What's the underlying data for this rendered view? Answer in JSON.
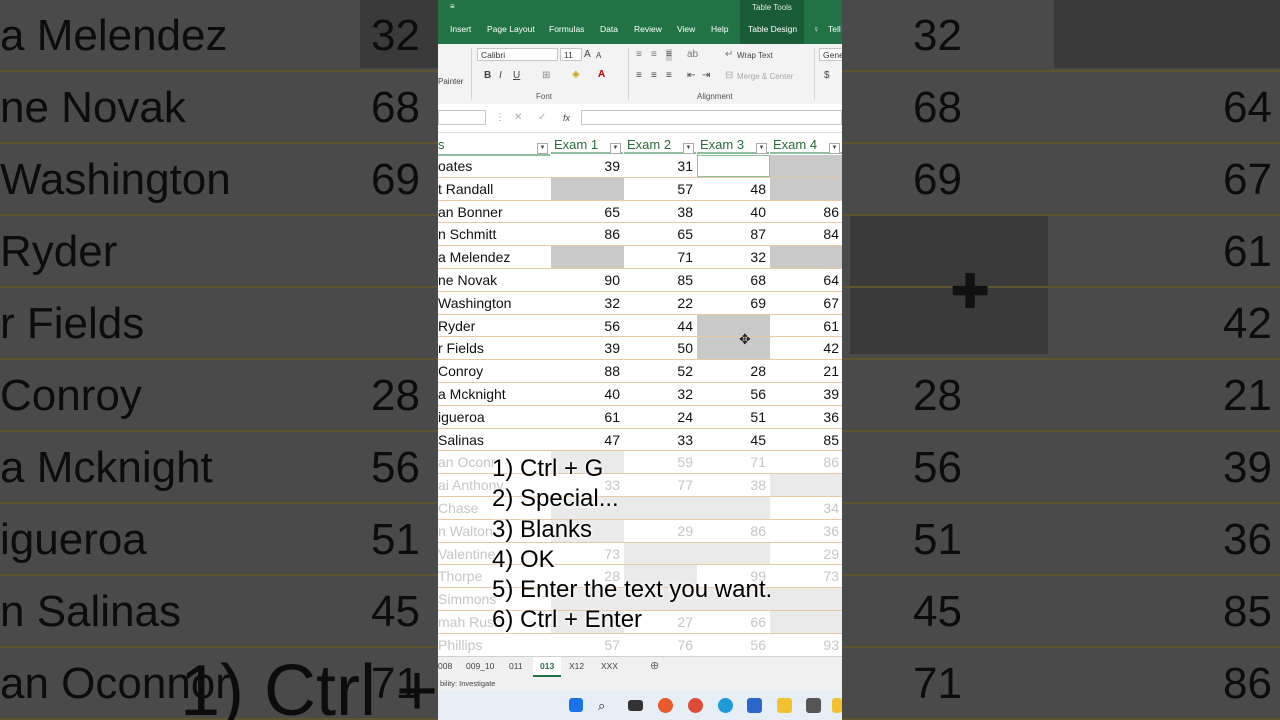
{
  "ribbon_tabs": [
    "Insert",
    "Page Layout",
    "Formulas",
    "Data",
    "Review",
    "View",
    "Help",
    "Table Design",
    "Tell"
  ],
  "table_tools_label": "Table Tools",
  "ribbon": {
    "painter": "Painter",
    "font_name": "Calibri",
    "font_size": "11",
    "wrap_text": "Wrap Text",
    "merge_center": "Merge & Center",
    "number_format": "Gene",
    "group_font": "Font",
    "group_alignment": "Alignment",
    "bold": "B",
    "italic": "I",
    "underline": "U",
    "currency": "$"
  },
  "formula_bar": {
    "fx": "fx"
  },
  "columns": {
    "name_suffix": "s",
    "exam1": "Exam 1",
    "exam2": "Exam 2",
    "exam3": "Exam 3",
    "exam4": "Exam 4"
  },
  "rows": [
    {
      "name": "oates",
      "e1": "39",
      "e2": "31",
      "e3": "",
      "e4": ""
    },
    {
      "name": "t Randall",
      "e1": "",
      "e2": "57",
      "e3": "48",
      "e4": ""
    },
    {
      "name": "an Bonner",
      "e1": "65",
      "e2": "38",
      "e3": "40",
      "e4": "86"
    },
    {
      "name": "n Schmitt",
      "e1": "86",
      "e2": "65",
      "e3": "87",
      "e4": "84"
    },
    {
      "name": "a Melendez",
      "e1": "",
      "e2": "71",
      "e3": "32",
      "e4": ""
    },
    {
      "name": "ne Novak",
      "e1": "90",
      "e2": "85",
      "e3": "68",
      "e4": "64"
    },
    {
      "name": " Washington",
      "e1": "32",
      "e2": "22",
      "e3": "69",
      "e4": "67"
    },
    {
      "name": " Ryder",
      "e1": "56",
      "e2": "44",
      "e3": "",
      "e4": "61"
    },
    {
      "name": "r Fields",
      "e1": "39",
      "e2": "50",
      "e3": "",
      "e4": "42"
    },
    {
      "name": "Conroy",
      "e1": "88",
      "e2": "52",
      "e3": "28",
      "e4": "21"
    },
    {
      "name": "a Mcknight",
      "e1": "40",
      "e2": "32",
      "e3": "56",
      "e4": "39"
    },
    {
      "name": "igueroa",
      "e1": "61",
      "e2": "24",
      "e3": "51",
      "e4": "36"
    },
    {
      "name": " Salinas",
      "e1": "47",
      "e2": "33",
      "e3": "45",
      "e4": "85"
    },
    {
      "name": "an Oconr",
      "e1": "",
      "e2": "59",
      "e3": "71",
      "e4": "86"
    },
    {
      "name": "ai Anthony",
      "e1": "33",
      "e2": "77",
      "e3": "38",
      "e4": ""
    },
    {
      "name": " Chase",
      "e1": "",
      "e2": "",
      "e3": "",
      "e4": "34"
    },
    {
      "name": "n Walton",
      "e1": "",
      "e2": "29",
      "e3": "86",
      "e4": "36"
    },
    {
      "name": " Valentine",
      "e1": "73",
      "e2": "",
      "e3": "",
      "e4": "29"
    },
    {
      "name": " Thorpe",
      "e1": "28",
      "e2": "",
      "e3": "99",
      "e4": "73"
    },
    {
      "name": " Simmons",
      "e1": "",
      "e2": "",
      "e3": "",
      "e4": ""
    },
    {
      "name": "mah Rush",
      "e1": "",
      "e2": "27",
      "e3": "66",
      "e4": ""
    },
    {
      "name": " Phillips",
      "e1": "57",
      "e2": "76",
      "e3": "56",
      "e4": "93"
    }
  ],
  "instructions": [
    "1) Ctrl + G",
    "2) Special...",
    "3) Blanks",
    "4) OK",
    "5) Enter the text you want.",
    "6) Ctrl + Enter"
  ],
  "sheet_tabs": [
    "008",
    "009_10",
    "011",
    "013",
    "X12",
    "XXX"
  ],
  "active_sheet": "013",
  "status": "bility: Investigate",
  "background_left": {
    "names": [
      "a Melendez",
      "ne Novak",
      "Washington",
      "Ryder",
      "r Fields",
      "Conroy",
      "a Mcknight",
      "igueroa",
      "n Salinas",
      "an Oconnor"
    ],
    "nums": [
      "32",
      "68",
      "69",
      "",
      "",
      "28",
      "56",
      "51",
      "45",
      "71"
    ],
    "bottom_text": "1) Ctrl +"
  },
  "background_right": {
    "nums": [
      "",
      "64",
      "67",
      "61",
      "42",
      "21",
      "39",
      "36",
      "85",
      "86"
    ]
  },
  "colors": {
    "excel_green": "#217346",
    "blank_fill": "#c9c9c9",
    "row_line": "#e7c8a4"
  }
}
